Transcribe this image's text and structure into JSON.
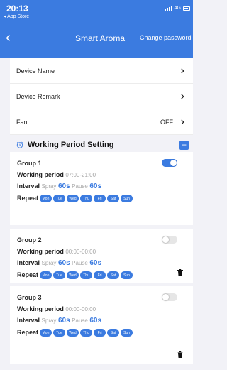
{
  "status_bar": {
    "time": "20:13",
    "back_app": "◂ App Store",
    "network": "4G"
  },
  "nav": {
    "back_icon": "‹",
    "title": "Smart Aroma",
    "action": "Change password"
  },
  "settings": [
    {
      "label": "Device Name",
      "value": ""
    },
    {
      "label": "Device Remark",
      "value": ""
    },
    {
      "label": "Fan",
      "value": "OFF"
    }
  ],
  "section": {
    "label": "Working Period Setting",
    "add_icon": "+"
  },
  "labels": {
    "working_period": "Working period",
    "interval": "Interval",
    "spray": "Spray",
    "pause": "Pause",
    "repeat": "Repeat"
  },
  "groups": [
    {
      "name": "Group 1",
      "period": "07:00-21:00",
      "spray": "60s",
      "pause": "60s",
      "days": [
        "Mon",
        "Tue",
        "Wed",
        "Thu",
        "Fri",
        "Sat",
        "Sun"
      ],
      "enabled": true
    },
    {
      "name": "Group 2",
      "period": "00:00-00:00",
      "spray": "60s",
      "pause": "60s",
      "days": [
        "Mon",
        "Tue",
        "Wed",
        "Thu",
        "Fri",
        "Sat",
        "Sun"
      ],
      "enabled": false
    },
    {
      "name": "Group 3",
      "period": "00:00-00:00",
      "spray": "60s",
      "pause": "60s",
      "days": [
        "Mon",
        "Tue",
        "Wed",
        "Thu",
        "Fri",
        "Sat",
        "Sun"
      ],
      "enabled": false
    }
  ],
  "colors": {
    "accent": "#3b7be0",
    "background": "#f2f2f7"
  }
}
